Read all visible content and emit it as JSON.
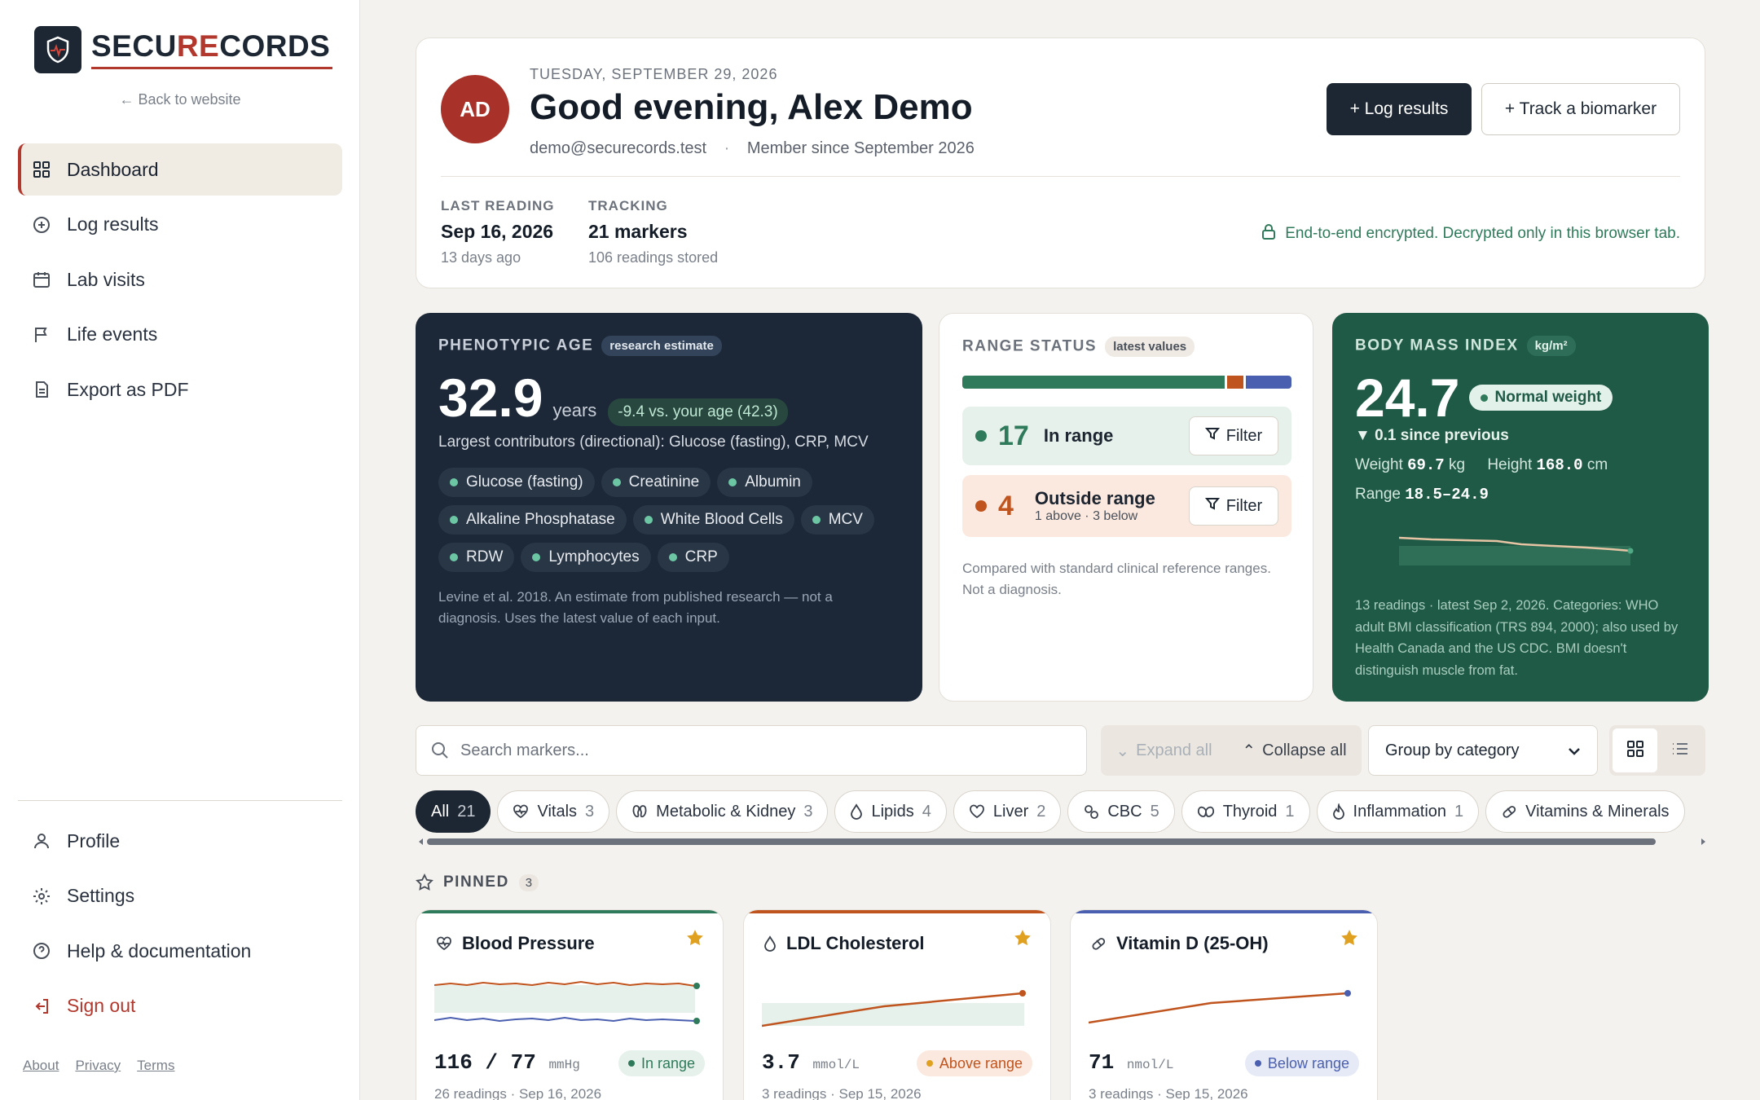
{
  "app": {
    "brand_prefix": "SECU",
    "brand_accent": "RE",
    "brand_suffix": "CORDS",
    "back_link": "← Back to website"
  },
  "sidebar": {
    "nav": [
      {
        "label": "Dashboard",
        "icon": "grid-icon",
        "active": true
      },
      {
        "label": "Log results",
        "icon": "plus-circle-icon"
      },
      {
        "label": "Lab visits",
        "icon": "calendar-icon"
      },
      {
        "label": "Life events",
        "icon": "flag-icon"
      },
      {
        "label": "Export as PDF",
        "icon": "document-icon"
      }
    ],
    "bottom": [
      {
        "label": "Profile",
        "icon": "user-icon"
      },
      {
        "label": "Settings",
        "icon": "gear-icon"
      },
      {
        "label": "Help & documentation",
        "icon": "help-circle-icon"
      },
      {
        "label": "Sign out",
        "icon": "sign-out-icon"
      }
    ],
    "footer": [
      "About",
      "Privacy",
      "Terms"
    ]
  },
  "header": {
    "avatar_initials": "AD",
    "date": "TUESDAY, SEPTEMBER 29, 2026",
    "greeting": "Good evening, Alex Demo",
    "email": "demo@securecords.test",
    "separator": "·",
    "member_since": "Member since September 2026",
    "log_button": "+ Log results",
    "track_button": "+ Track a biomarker",
    "last_reading": {
      "label": "LAST READING",
      "value": "Sep 16, 2026",
      "sub": "13 days ago"
    },
    "tracking": {
      "label": "TRACKING",
      "value": "21 markers",
      "sub": "106 readings stored"
    },
    "encryption_note": "End-to-end encrypted. Decrypted only in this browser tab."
  },
  "phenotypic": {
    "title": "PHENOTYPIC AGE",
    "tag": "research estimate",
    "value": "32.9",
    "unit": "years",
    "delta": "-9.4 vs. your age (42.3)",
    "contributors": "Largest contributors (directional): Glucose (fasting), CRP, MCV",
    "chips": [
      "Glucose (fasting)",
      "Creatinine",
      "Albumin",
      "Alkaline Phosphatase",
      "White Blood Cells",
      "MCV",
      "RDW",
      "Lymphocytes",
      "CRP"
    ],
    "note": "Levine et al. 2018. An estimate from published research — not a diagnosis. Uses the latest value of each input."
  },
  "range_status": {
    "title": "RANGE STATUS",
    "tag": "latest values",
    "in_range_fraction": 0.81,
    "above_fraction": 0.05,
    "below_fraction": 0.14,
    "in_range_count": "17",
    "in_range_label": "In range",
    "outside_count": "4",
    "outside_label": "Outside range",
    "outside_sub": "1 above · 3 below",
    "filter_label": "Filter",
    "note": "Compared with standard clinical reference ranges. Not a diagnosis."
  },
  "bmi": {
    "title": "BODY MASS INDEX",
    "tag": "kg/m²",
    "value": "24.7",
    "status": "Normal weight",
    "change": "▼ 0.1 since previous",
    "weight_label": "Weight",
    "weight_value": "69.7",
    "weight_unit": "kg",
    "height_label": "Height",
    "height_value": "168.0",
    "height_unit": "cm",
    "range_label": "Range",
    "range_value": "18.5–24.9",
    "note": "13 readings · latest Sep 2, 2026. Categories: WHO adult BMI classification (TRS 894, 2000); also used by Health Canada and the US CDC. BMI doesn't distinguish muscle from fat."
  },
  "toolbar": {
    "search_placeholder": "Search markers...",
    "expand_all": "Expand all",
    "collapse_all": "Collapse all",
    "group_by": "Group by category"
  },
  "categories": [
    {
      "label": "All",
      "count": "21",
      "active": true
    },
    {
      "label": "Vitals",
      "count": "3",
      "icon": "heartbeat-icon"
    },
    {
      "label": "Metabolic & Kidney",
      "count": "3",
      "icon": "kidney-icon"
    },
    {
      "label": "Lipids",
      "count": "4",
      "icon": "droplet-icon"
    },
    {
      "label": "Liver",
      "count": "2",
      "icon": "heart-icon"
    },
    {
      "label": "CBC",
      "count": "5",
      "icon": "cells-icon"
    },
    {
      "label": "Thyroid",
      "count": "1",
      "icon": "thyroid-icon"
    },
    {
      "label": "Inflammation",
      "count": "1",
      "icon": "flame-icon"
    },
    {
      "label": "Vitamins & Minerals",
      "count": "",
      "icon": "pill-icon"
    }
  ],
  "pinned": {
    "label": "PINNED",
    "count": "3",
    "cards": [
      {
        "title": "Blood Pressure",
        "icon": "heartbeat-icon",
        "value": "116 / 77",
        "unit": "mmHg",
        "status": "In range",
        "readings": "26 readings · Sep 16, 2026",
        "accent": "#2f7a5a"
      },
      {
        "title": "LDL Cholesterol",
        "icon": "droplet-icon",
        "value": "3.7",
        "unit": "mmol/L",
        "status": "Above range",
        "readings": "3 readings · Sep 15, 2026",
        "accent": "#c0541e"
      },
      {
        "title": "Vitamin D (25-OH)",
        "icon": "pill-icon",
        "value": "71",
        "unit": "nmol/L",
        "status": "Below range",
        "readings": "3 readings · Sep 15, 2026",
        "accent": "#4a5fb0"
      }
    ]
  },
  "colors": {
    "brand_red": "#b2372d",
    "navy": "#1d2733",
    "green": "#2f7a5a",
    "orange": "#c0541e",
    "blue": "#4a5fb0"
  }
}
